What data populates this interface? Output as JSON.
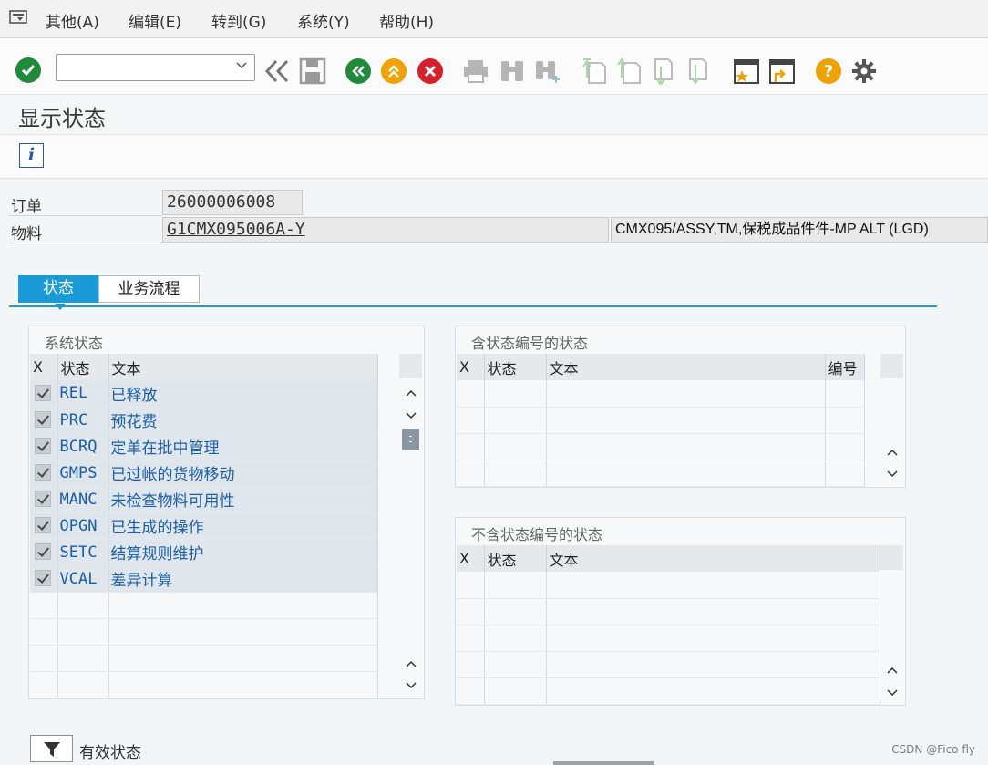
{
  "menubar": {
    "items": [
      "其他(A)",
      "编辑(E)",
      "转到(G)",
      "系统(Y)",
      "帮助(H)"
    ]
  },
  "toolbar": {
    "command_value": "",
    "icons": [
      "enter-icon",
      "back-double-icon",
      "save-icon",
      "back-icon",
      "exit-icon",
      "cancel-icon",
      "print-icon",
      "find-icon",
      "find-next-icon",
      "first-page-icon",
      "prev-page-icon",
      "next-page-icon",
      "last-page-icon",
      "new-session-icon",
      "shortcut-icon",
      "help-icon",
      "settings-icon"
    ]
  },
  "title": "显示状态",
  "header": {
    "order_label": "订单",
    "order_value": "26000006008",
    "material_label": "物料",
    "material_value": "G1CMX095006A-Y",
    "material_desc": "CMX095/ASSY,TM,保税成品件件-MP ALT (LGD)"
  },
  "tabs": [
    {
      "label": "状态",
      "active": true
    },
    {
      "label": "业务流程",
      "active": false
    }
  ],
  "system_status": {
    "title": "系统状态",
    "columns": [
      "X",
      "状态",
      "文本"
    ],
    "rows": [
      {
        "checked": true,
        "code": "REL",
        "text": "已释放"
      },
      {
        "checked": true,
        "code": "PRC",
        "text": "预花费"
      },
      {
        "checked": true,
        "code": "BCRQ",
        "text": "定单在批中管理"
      },
      {
        "checked": true,
        "code": "GMPS",
        "text": "已过帐的货物移动"
      },
      {
        "checked": true,
        "code": "MANC",
        "text": "未检查物料可用性"
      },
      {
        "checked": true,
        "code": "OPGN",
        "text": "已生成的操作"
      },
      {
        "checked": true,
        "code": "SETC",
        "text": "结算规则维护"
      },
      {
        "checked": true,
        "code": "VCAL",
        "text": "差异计算"
      }
    ]
  },
  "user_status_numbered": {
    "title": "含状态编号的状态",
    "columns": [
      "X",
      "状态",
      "文本",
      "编号"
    ]
  },
  "user_status_unnumbered": {
    "title": "不含状态编号的状态",
    "columns": [
      "X",
      "状态",
      "文本"
    ]
  },
  "footer": {
    "filter_label": "有效状态",
    "watermark": "CSDN @Fico fly"
  },
  "colors": {
    "accent": "#1a9ad6",
    "enter_green": "#1f8a3a",
    "nav_yellow": "#f0a300",
    "cancel_red": "#d81e2b",
    "code_blue": "#1b5fa8"
  }
}
